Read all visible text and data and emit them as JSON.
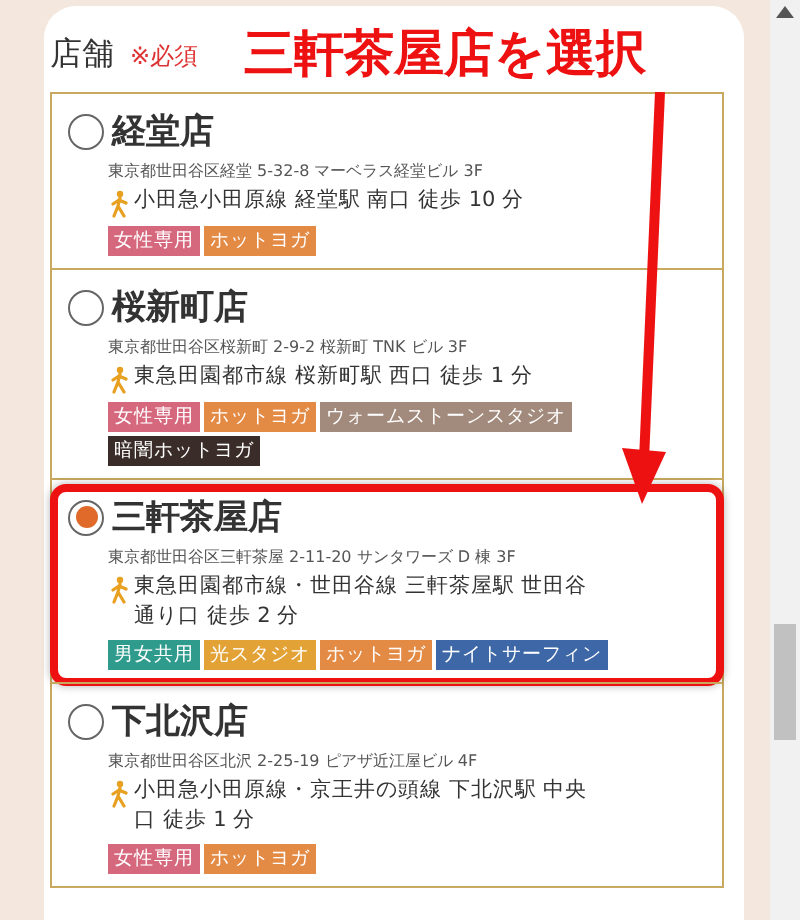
{
  "annotation": {
    "text": "三軒茶屋店を選択"
  },
  "field": {
    "label": "店舗",
    "required": "※必須"
  },
  "stores": [
    {
      "name": "経堂店",
      "selected": false,
      "highlighted": false,
      "address": "東京都世田谷区経堂 5-32-8 マーベラス経堂ビル 3F",
      "access": "小田急小田原線 経堂駅 南口 徒歩 10 分",
      "tags": [
        {
          "text": "女性専用",
          "color": "#d6687e"
        },
        {
          "text": "ホットヨガ",
          "color": "#e38a45"
        }
      ]
    },
    {
      "name": "桜新町店",
      "selected": false,
      "highlighted": false,
      "address": "東京都世田谷区桜新町 2-9-2 桜新町 TNK ビル 3F",
      "access": "東急田園都市線 桜新町駅 西口 徒歩 1 分",
      "tags": [
        {
          "text": "女性専用",
          "color": "#d6687e"
        },
        {
          "text": "ホットヨガ",
          "color": "#e38a45"
        },
        {
          "text": "ウォームストーンスタジオ",
          "color": "#a28a7c"
        },
        {
          "text": "暗闇ホットヨガ",
          "color": "#3a2c28"
        }
      ]
    },
    {
      "name": "三軒茶屋店",
      "selected": true,
      "highlighted": true,
      "address": "東京都世田谷区三軒茶屋 2-11-20 サンタワーズ D 棟 3F",
      "access": "東急田園都市線・世田谷線 三軒茶屋駅 世田谷通り口 徒歩 2 分",
      "tags": [
        {
          "text": "男女共用",
          "color": "#2f9b8c"
        },
        {
          "text": "光スタジオ",
          "color": "#e3a236"
        },
        {
          "text": "ホットヨガ",
          "color": "#e38a45"
        },
        {
          "text": "ナイトサーフィン",
          "color": "#3d67a6"
        }
      ]
    },
    {
      "name": "下北沢店",
      "selected": false,
      "highlighted": false,
      "address": "東京都世田谷区北沢 2-25-19 ピアザ近江屋ビル 4F",
      "access": "小田急小田原線・京王井の頭線 下北沢駅 中央口 徒歩 1 分",
      "tags": [
        {
          "text": "女性専用",
          "color": "#d6687e"
        },
        {
          "text": "ホットヨガ",
          "color": "#e38a45"
        }
      ]
    }
  ]
}
